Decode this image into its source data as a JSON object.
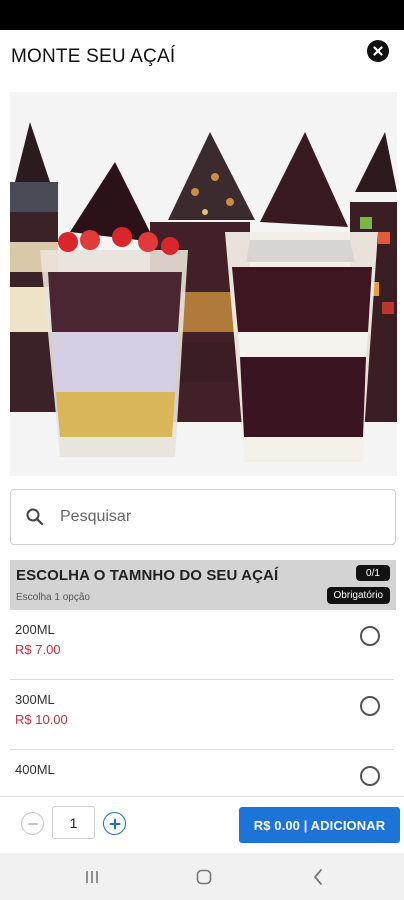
{
  "header": {
    "title": "MONTE SEU AÇAÍ"
  },
  "hero": {
    "description_icon": "acai-cups-photo"
  },
  "search": {
    "placeholder": "Pesquisar",
    "value": ""
  },
  "section": {
    "title": "ESCOLHA O TAMNHO DO SEU AÇAÍ",
    "subtitle": "Escolha 1 opção",
    "count": "0/1",
    "required": "Obrigatório"
  },
  "options": [
    {
      "name": "200ML",
      "price": "R$ 7.00"
    },
    {
      "name": "300ML",
      "price": "R$ 10.00"
    },
    {
      "name": "400ML",
      "price": ""
    }
  ],
  "footer": {
    "quantity": "1",
    "add_label": "R$ 0.00 | ADICIONAR"
  },
  "colors": {
    "accent": "#1c73d8",
    "price": "#c0324a",
    "section_bg": "#d3d3d3"
  }
}
